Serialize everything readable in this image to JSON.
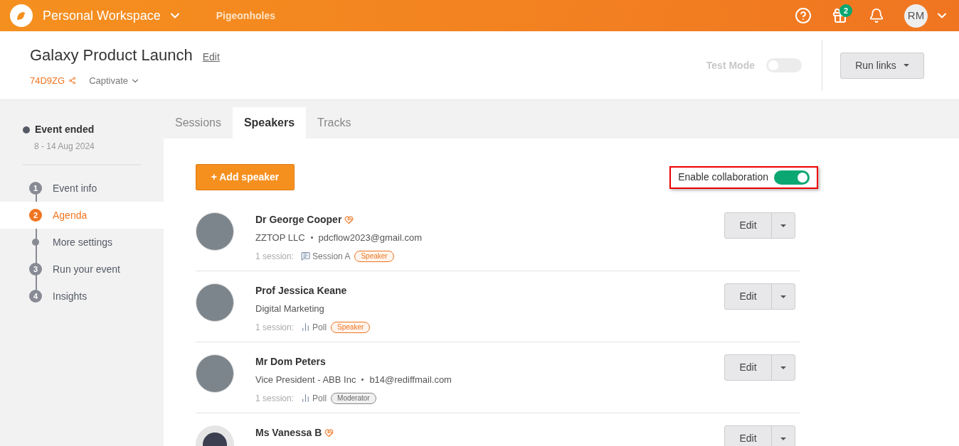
{
  "top_bar": {
    "workspace": "Personal Workspace",
    "nav_link": "Pigeonholes",
    "gift_badge": "2",
    "avatar": "RM"
  },
  "event": {
    "title": "Galaxy Product Launch",
    "edit_link": "Edit",
    "code": "74D9ZG",
    "plan": "Captivate",
    "test_mode": {
      "label": "Test Mode",
      "on": false,
      "disabled": true
    },
    "run_links": "Run links"
  },
  "status": {
    "label": "Event ended",
    "dates": "8 - 14 Aug 2024"
  },
  "steps": [
    {
      "kind": "numbered",
      "number": "1",
      "label": "Event info",
      "selected": false
    },
    {
      "kind": "numbered",
      "number": "2",
      "label": "Agenda",
      "selected": true
    },
    {
      "kind": "dot",
      "label": "More settings",
      "selected": false
    },
    {
      "kind": "numbered",
      "number": "3",
      "label": "Run your event",
      "selected": false
    },
    {
      "kind": "numbered",
      "number": "4",
      "label": "Insights",
      "selected": false
    }
  ],
  "tabs": [
    {
      "label": "Sessions",
      "selected": false
    },
    {
      "label": "Speakers",
      "selected": true
    },
    {
      "label": "Tracks",
      "selected": false
    }
  ],
  "add_button": "+ Add speaker",
  "collaboration": {
    "label": "Enable collaboration",
    "on": true
  },
  "speakers": [
    {
      "name": "Dr George Cooper",
      "collaborator": true,
      "details": [
        "ZZTOP LLC",
        "pdcflow2023@gmail.com"
      ],
      "sessions_label": "1 session:",
      "session": {
        "kind": "session",
        "title": "Session A"
      },
      "role": {
        "kind": "speaker",
        "label": "Speaker"
      },
      "kind": "photo",
      "edit": "Edit"
    },
    {
      "name": "Prof Jessica Keane",
      "collaborator": false,
      "details": [
        "Digital Marketing"
      ],
      "sessions_label": "1 session:",
      "session": {
        "kind": "poll",
        "title": "Poll"
      },
      "role": {
        "kind": "speaker",
        "label": "Speaker"
      },
      "kind": "photo",
      "edit": "Edit"
    },
    {
      "name": "Mr Dom Peters",
      "collaborator": false,
      "details": [
        "Vice President - ABB Inc",
        "b14@rediffmail.com"
      ],
      "sessions_label": "1 session:",
      "session": {
        "kind": "poll",
        "title": "Poll"
      },
      "role": {
        "kind": "moderator",
        "label": "Moderator"
      },
      "kind": "photo",
      "edit": "Edit"
    },
    {
      "name": "Ms Vanessa B",
      "collaborator": true,
      "kind": "silhouette",
      "edit": "Edit"
    }
  ]
}
